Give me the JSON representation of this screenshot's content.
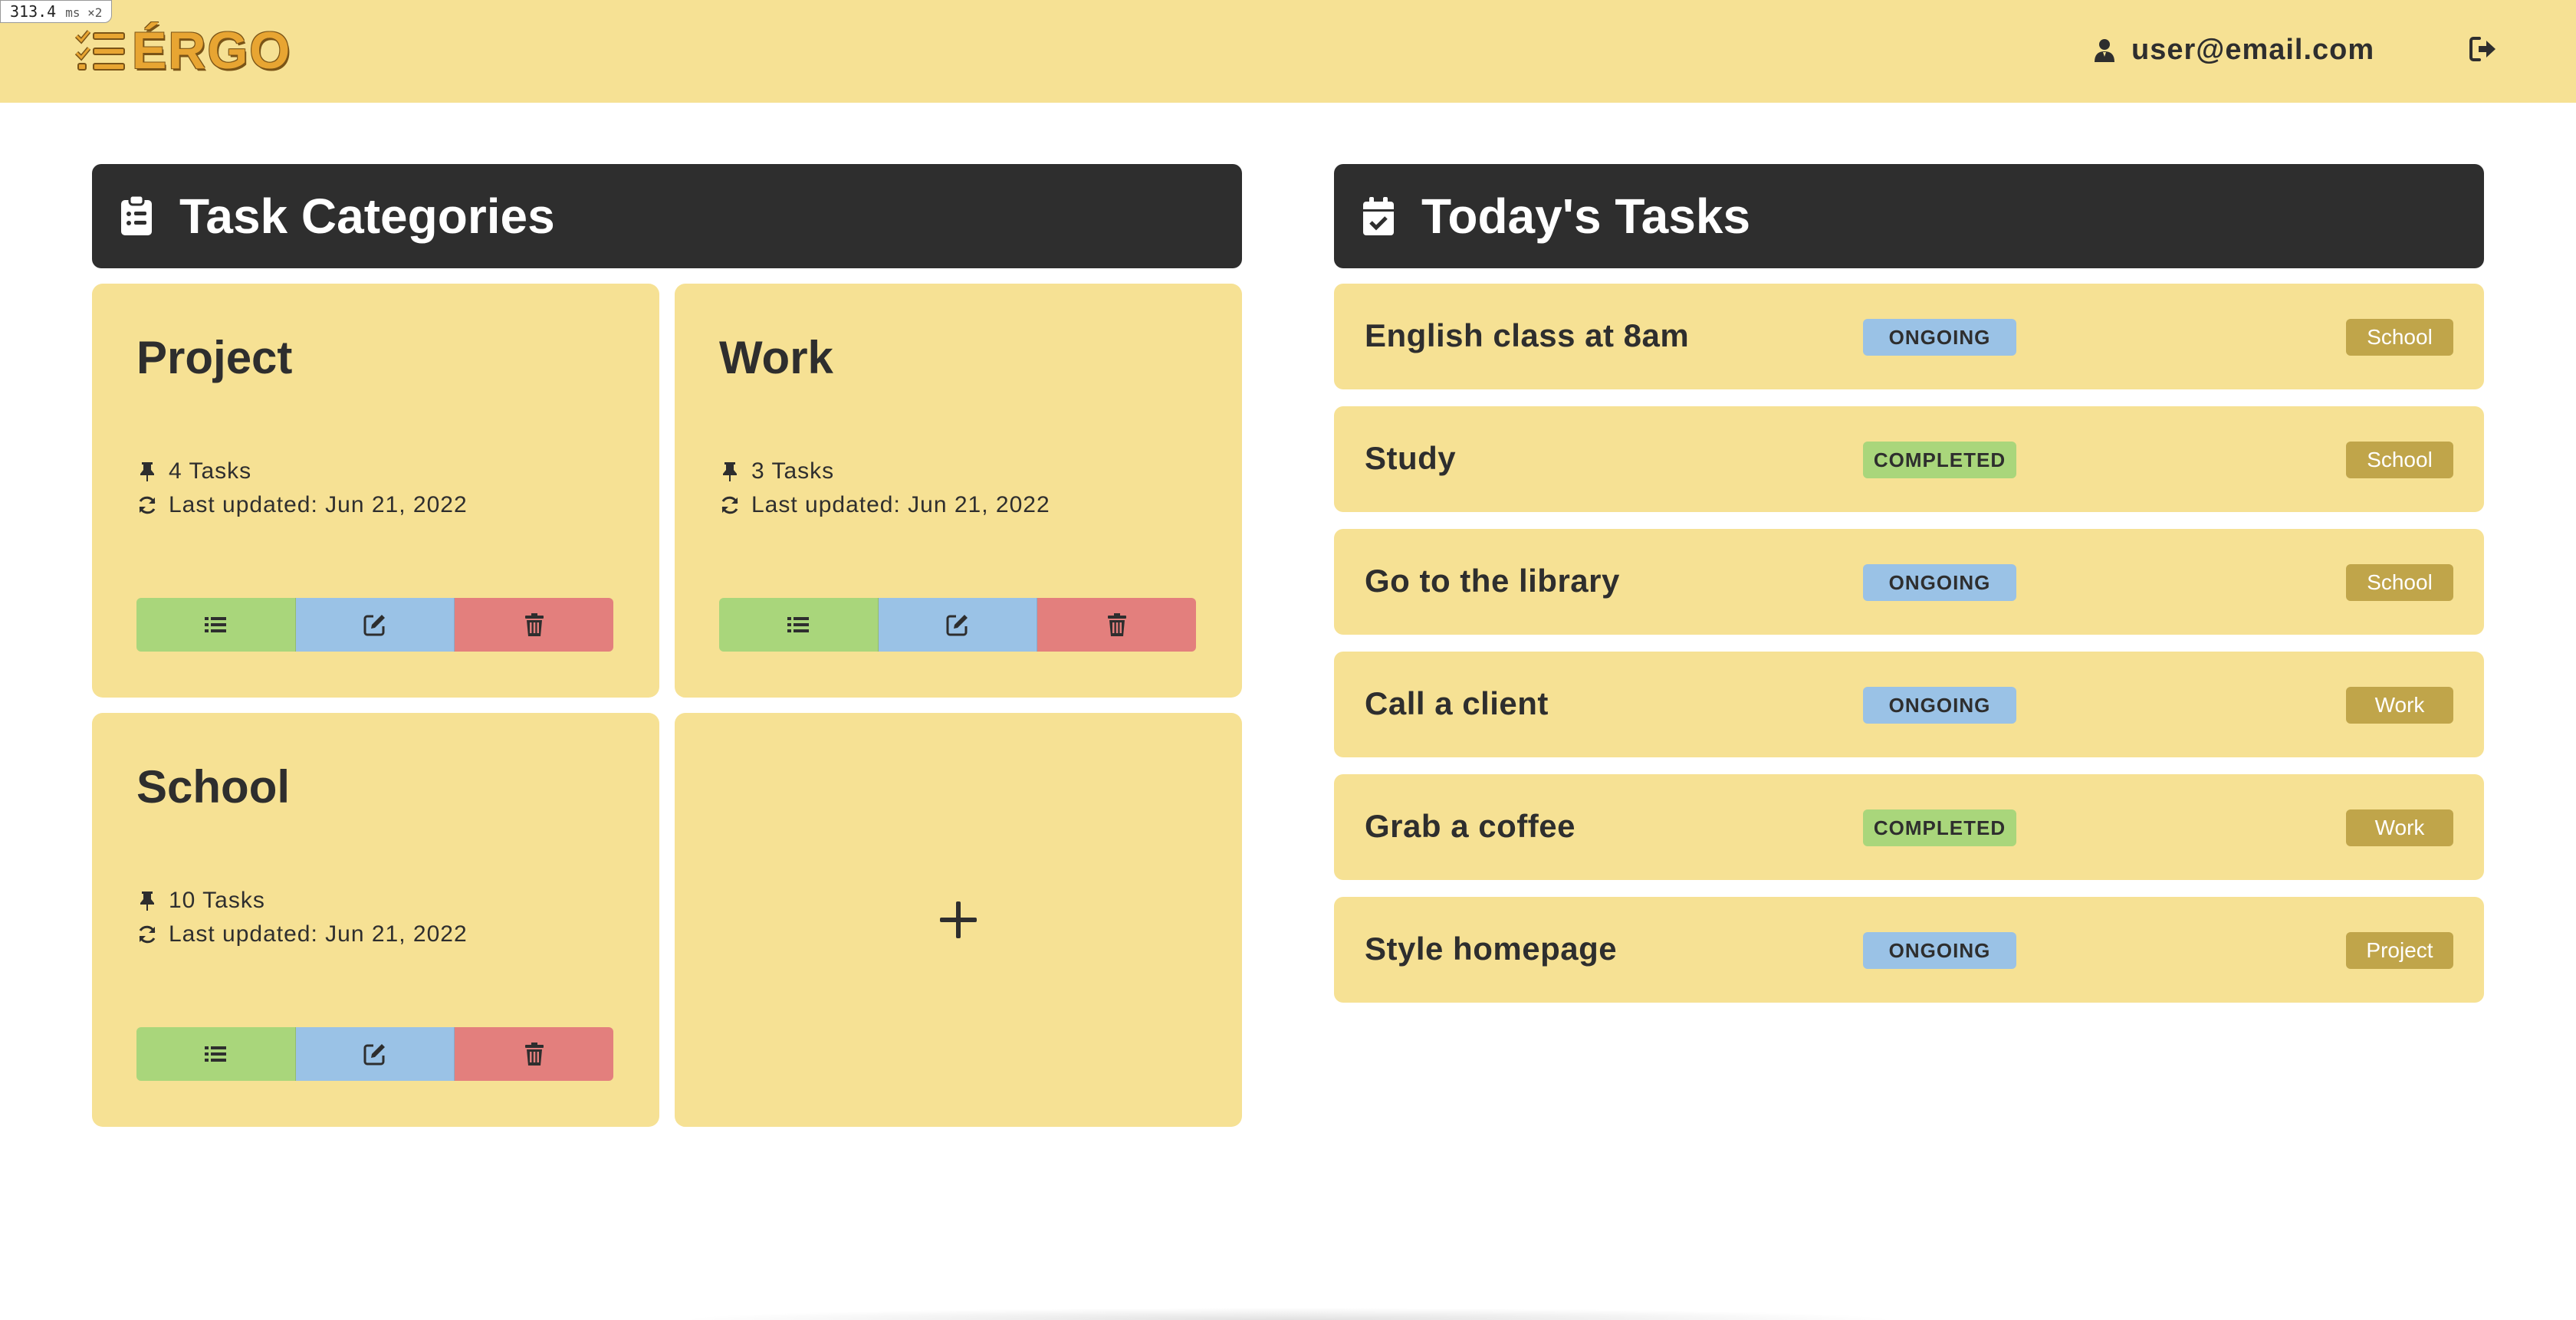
{
  "perf": {
    "value": "313.4",
    "unit": "ms ×2"
  },
  "header": {
    "logo_text": "ÉRGO",
    "user_email": "user@email.com"
  },
  "categories_panel": {
    "title": "Task Categories",
    "cards": [
      {
        "name": "Project",
        "tasks": "4 Tasks",
        "updated": "Last updated: Jun 21, 2022"
      },
      {
        "name": "Work",
        "tasks": "3 Tasks",
        "updated": "Last updated: Jun 21, 2022"
      },
      {
        "name": "School",
        "tasks": "10 Tasks",
        "updated": "Last updated: Jun 21, 2022"
      }
    ],
    "add_icon": "plus-icon"
  },
  "today_panel": {
    "title": "Today's Tasks",
    "tasks": [
      {
        "name": "English class at 8am",
        "status": "ONGOING",
        "category": "School"
      },
      {
        "name": "Study",
        "status": "COMPLETED",
        "category": "School"
      },
      {
        "name": "Go to the library",
        "status": "ONGOING",
        "category": "School"
      },
      {
        "name": "Call a client",
        "status": "ONGOING",
        "category": "Work"
      },
      {
        "name": "Grab a coffee",
        "status": "COMPLETED",
        "category": "Work"
      },
      {
        "name": "Style homepage",
        "status": "ONGOING",
        "category": "Project"
      }
    ]
  },
  "colors": {
    "header_bg": "#f6e194",
    "panel_head_bg": "#2e2e2e",
    "card_bg": "#f6e194",
    "view_button": "#a9d67b",
    "edit_button": "#9ac2e6",
    "delete_button": "#e37f7d",
    "ongoing_badge": "#9ac2e6",
    "completed_badge": "#a9d67b",
    "category_badge": "#c0a54a",
    "logo": "#e8a532"
  }
}
